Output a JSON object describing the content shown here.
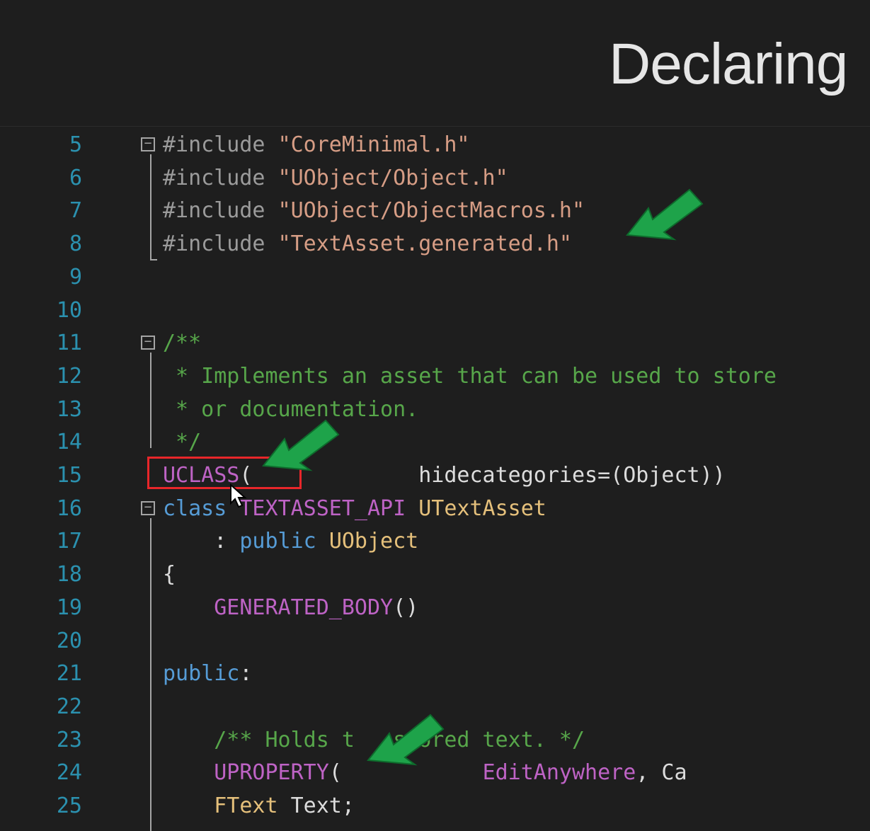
{
  "slide": {
    "title": "Declaring"
  },
  "code": {
    "lines": [
      {
        "num": "5",
        "segments": [
          {
            "c": "pp",
            "t": "#include "
          },
          {
            "c": "str",
            "t": "\"CoreMinimal.h\""
          }
        ]
      },
      {
        "num": "6",
        "segments": [
          {
            "c": "pp",
            "t": "#include "
          },
          {
            "c": "str",
            "t": "\"UObject/Object.h\""
          }
        ]
      },
      {
        "num": "7",
        "segments": [
          {
            "c": "pp",
            "t": "#include "
          },
          {
            "c": "str",
            "t": "\"UObject/ObjectMacros.h\""
          }
        ]
      },
      {
        "num": "8",
        "segments": [
          {
            "c": "pp",
            "t": "#include "
          },
          {
            "c": "str",
            "t": "\"TextAsset.generated.h\""
          }
        ]
      },
      {
        "num": "9",
        "segments": []
      },
      {
        "num": "10",
        "segments": []
      },
      {
        "num": "11",
        "segments": [
          {
            "c": "cmt",
            "t": "/**"
          }
        ]
      },
      {
        "num": "12",
        "segments": [
          {
            "c": "cmt",
            "t": " * Implements an asset that can be used to store"
          }
        ]
      },
      {
        "num": "13",
        "segments": [
          {
            "c": "cmt",
            "t": " * or documentation."
          }
        ]
      },
      {
        "num": "14",
        "segments": [
          {
            "c": "cmt",
            "t": " */"
          }
        ]
      },
      {
        "num": "15",
        "segments": [
          {
            "c": "mac",
            "t": "UCLASS"
          },
          {
            "c": "plain",
            "t": "(             hidecategories=(Object))"
          }
        ]
      },
      {
        "num": "16",
        "segments": [
          {
            "c": "kw",
            "t": "class "
          },
          {
            "c": "mac",
            "t": "TEXTASSET_API "
          },
          {
            "c": "typ",
            "t": "UTextAsset"
          }
        ]
      },
      {
        "num": "17",
        "segments": [
          {
            "c": "plain",
            "t": "    : "
          },
          {
            "c": "kw",
            "t": "public "
          },
          {
            "c": "typ",
            "t": "UObject"
          }
        ]
      },
      {
        "num": "18",
        "segments": [
          {
            "c": "plain",
            "t": "{"
          }
        ]
      },
      {
        "num": "19",
        "segments": [
          {
            "c": "mac",
            "t": "    GENERATED_BODY"
          },
          {
            "c": "plain",
            "t": "()"
          }
        ]
      },
      {
        "num": "20",
        "segments": []
      },
      {
        "num": "21",
        "segments": [
          {
            "c": "kw",
            "t": "public"
          },
          {
            "c": "plain",
            "t": ":"
          }
        ]
      },
      {
        "num": "22",
        "segments": []
      },
      {
        "num": "23",
        "segments": [
          {
            "c": "cmt",
            "t": "    /** Holds t   stored text. */"
          }
        ]
      },
      {
        "num": "24",
        "segments": [
          {
            "c": "mac",
            "t": "    UPROPERTY"
          },
          {
            "c": "plain",
            "t": "(           "
          },
          {
            "c": "mac",
            "t": "EditAnywhere"
          },
          {
            "c": "plain",
            "t": ", Ca"
          }
        ]
      },
      {
        "num": "25",
        "segments": [
          {
            "c": "typ",
            "t": "    FText "
          },
          {
            "c": "plain",
            "t": "Text;"
          }
        ]
      }
    ]
  },
  "fold_markers": {
    "glyph": "−",
    "lines": [
      "5",
      "11",
      "16"
    ]
  },
  "annotations": {
    "arrow_color": "#1ea34a",
    "highlight_color": "#e8262a",
    "arrows": [
      "include-generated-arrow",
      "uclass-arrow",
      "uproperty-arrow"
    ],
    "highlight": "uclass-highlight-box"
  },
  "colors": {
    "background": "#1e1e1e",
    "line_number": "#2b91af",
    "preprocessor": "#9b9b9b",
    "string": "#d69d85",
    "comment": "#57a64a",
    "macro": "#be63c5",
    "keyword": "#569cd6",
    "type": "#e5c07b"
  }
}
